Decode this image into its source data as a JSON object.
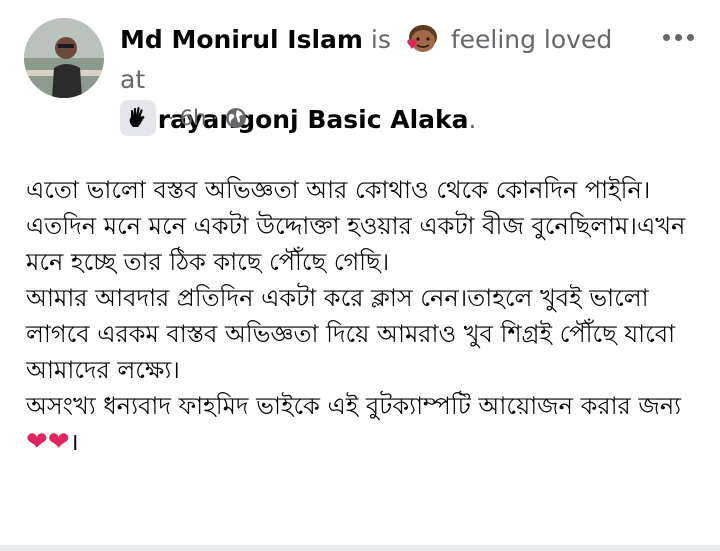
{
  "post": {
    "author": "Md Monirul Islam",
    "connector_is": "is",
    "feeling_text": "feeling loved at",
    "location": "Narayangonj Basic Alaka",
    "location_suffix": ".",
    "time": "6h",
    "separator": "·",
    "privacy_icon": "globe-icon",
    "badge_icon": "waving-hand-icon",
    "feeling_icon": "face-with-hearts-icon",
    "more_icon": "more-horizontal-icon"
  },
  "body": {
    "lines": [
      "এতো ভালো বস্তব অভিজ্ঞতা আর কোথাও থেকে কোনদিন পাইনি।",
      "এতদিন মনে মনে একটা উদ্দোক্তা হওয়ার একটা বীজ বুনেছিলাম।এখন মনে হচ্ছে তার ঠিক কাছে পৌঁছে গেছি।",
      "আমার আবদার প্রতিদিন একটা করে ক্লাস নেন।তাহলে খুবই ভালো লাগবে এরকম বাস্তব অভিজ্ঞতা দিয়ে আমরাও খুব শিগ্রই পৌঁছে যাবো আমাদের লক্ষ্যে।",
      "অসংখ্য ধন্যবাদ ফাহমিদ ভাইকে এই বুটক্যাম্পটি আয়োজন করার জন্য"
    ],
    "hearts": "❤❤",
    "end_mark": "।"
  },
  "colors": {
    "text": "#050505",
    "muted": "#65676b",
    "heart": "#e0245e",
    "badge_bg": "#e4e6eb"
  }
}
